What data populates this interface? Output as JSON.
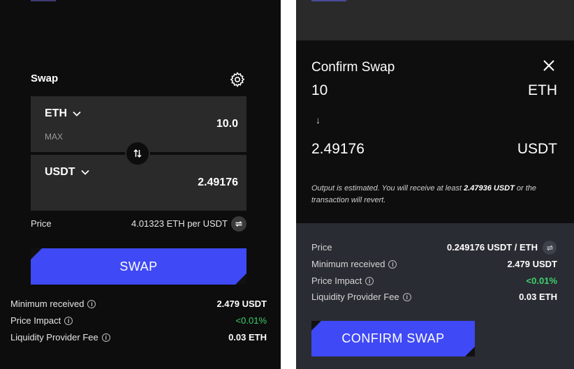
{
  "swap_panel": {
    "title": "Swap",
    "from_token": "ETH",
    "from_amount": "10.0",
    "max_label": "MAX",
    "to_token": "USDT",
    "to_amount": "2.49176",
    "price_label": "Price",
    "price_value": "4.01323 ETH per USDT",
    "swap_button": "SWAP",
    "details": {
      "min_received_label": "Minimum received",
      "min_received_value": "2.479 USDT",
      "price_impact_label": "Price Impact",
      "price_impact_value": "<0.01%",
      "lp_fee_label": "Liquidity Provider Fee",
      "lp_fee_value": "0.03 ETH"
    }
  },
  "confirm_modal": {
    "title": "Confirm Swap",
    "from_amount": "10",
    "from_token": "ETH",
    "to_amount": "2.49176",
    "to_token": "USDT",
    "arrow": "↓",
    "note_prefix": "Output is estimated. You will receive at least ",
    "note_amount": "2.47936 USDT",
    "note_suffix": " or the transaction will revert.",
    "price_label": "Price",
    "price_value": "0.249176 USDT / ETH",
    "min_received_label": "Minimum received",
    "min_received_value": "2.479 USDT",
    "price_impact_label": "Price Impact",
    "price_impact_value": "<0.01%",
    "lp_fee_label": "Liquidity Provider Fee",
    "lp_fee_value": "0.03 ETH",
    "confirm_button": "CONFIRM SWAP"
  },
  "colors": {
    "accent": "#3f49f5",
    "positive": "#3ecf6d",
    "panel_bg": "#0d0d0d",
    "input_bg": "#2a2a2a",
    "modal_footer_bg": "#2a2c33"
  },
  "icons": [
    "gear-icon",
    "chevron-down-icon",
    "swap-arrows-icon",
    "refresh-icon",
    "info-icon",
    "close-icon",
    "arrow-down-icon"
  ]
}
